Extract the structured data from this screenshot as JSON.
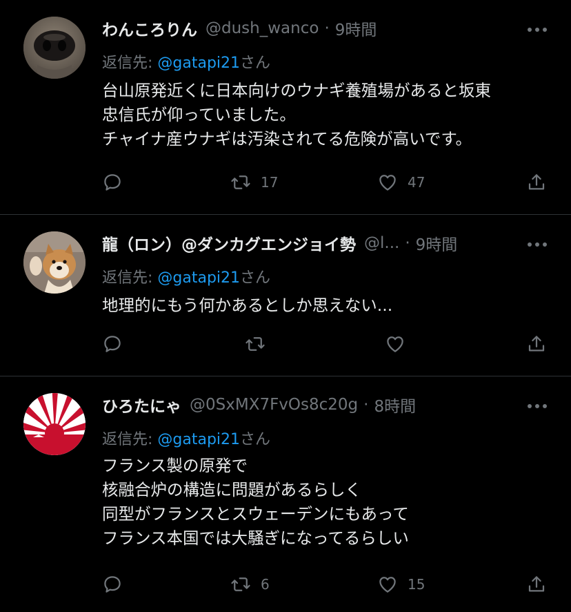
{
  "reply_prefix": "返信先: ",
  "reply_suffix": "さん",
  "dot": "·",
  "colors": {
    "background": "#000000",
    "text": "#e7e9ea",
    "muted": "#71767b",
    "link": "#1d9bf0",
    "divider": "#2f3336"
  },
  "tweets": [
    {
      "name": "わんころりん",
      "handle": "@dush_wanco",
      "time": "9時間",
      "reply_to": "@gatapi21",
      "text": "台山原発近くに日本向けのウナギ養殖場があると坂東\n忠信氏が仰っていました。\nチャイナ産ウナギは汚染されてる危険が高いです。",
      "replies": "",
      "retweets": "17",
      "likes": "47",
      "avatar": "dog-nose-photo"
    },
    {
      "name": "龍（ロン）@ダンカグエンジョイ勢",
      "handle": "@l...",
      "time": "9時間",
      "reply_to": "@gatapi21",
      "text": "地理的にもう何かあるとしか思えない...",
      "replies": "",
      "retweets": "",
      "likes": "",
      "avatar": "shiba-puppy-photo"
    },
    {
      "name": "ひろたにゃ",
      "handle": "@0SxMX7FvOs8c20g",
      "time": "8時間",
      "reply_to": "@gatapi21",
      "text": "フランス製の原発で\n核融合炉の構造に問題があるらしく\n同型がフランスとスウェーデンにもあって\nフランス本国では大騒ぎになってるらしい",
      "replies": "",
      "retweets": "6",
      "likes": "15",
      "avatar": "rising-sun-flag"
    }
  ]
}
